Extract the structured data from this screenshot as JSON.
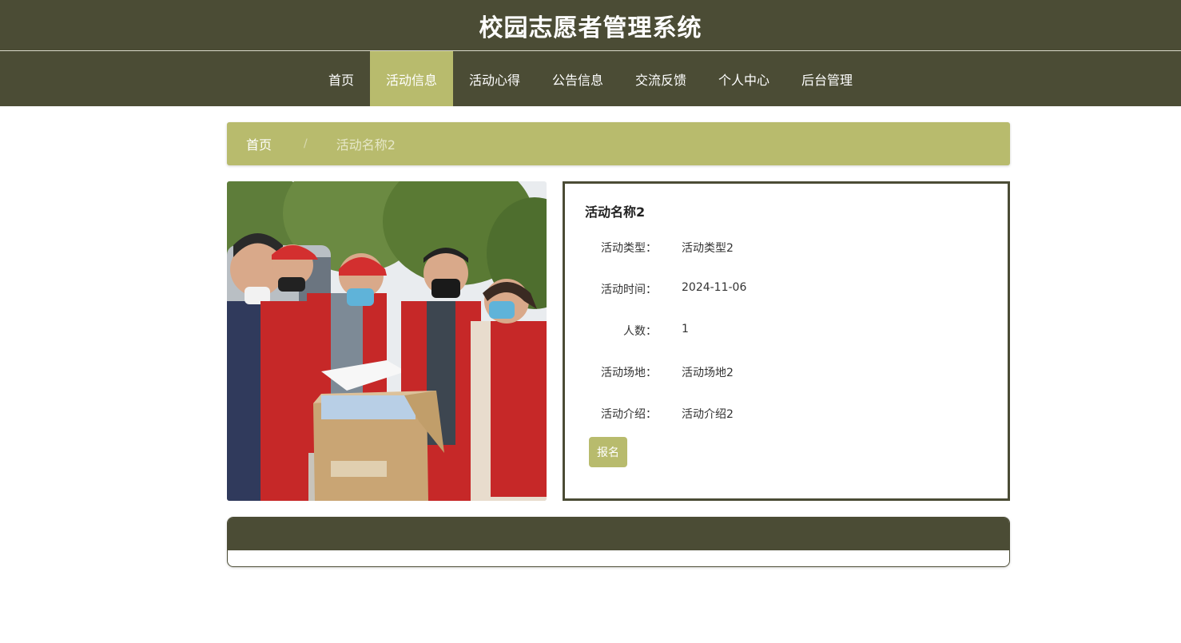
{
  "site": {
    "title": "校园志愿者管理系统"
  },
  "nav": {
    "items": [
      {
        "label": "首页"
      },
      {
        "label": "活动信息"
      },
      {
        "label": "活动心得"
      },
      {
        "label": "公告信息"
      },
      {
        "label": "交流反馈"
      },
      {
        "label": "个人中心"
      },
      {
        "label": "后台管理"
      }
    ],
    "active_index": 1
  },
  "breadcrumb": {
    "home": "首页",
    "separator": "/",
    "current": "活动名称2"
  },
  "detail": {
    "name": "活动名称2",
    "fields": [
      {
        "label": "活动类型：",
        "value": "活动类型2"
      },
      {
        "label": "活动时间：",
        "value": "2024-11-06"
      },
      {
        "label": "人数：",
        "value": "1"
      },
      {
        "label": "活动场地：",
        "value": "活动场地2"
      },
      {
        "label": "活动介绍：",
        "value": "活动介绍2"
      }
    ],
    "signup_label": "报名"
  },
  "colors": {
    "primary": "#4b4c35",
    "accent": "#b8bb6d"
  }
}
